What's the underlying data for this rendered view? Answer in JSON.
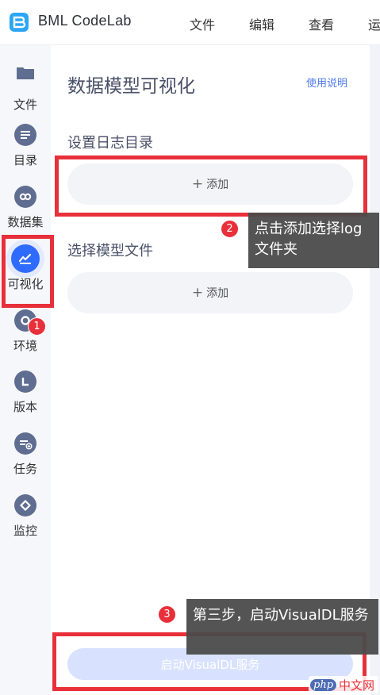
{
  "app": {
    "brand": "BML CodeLab",
    "menu": [
      "文件",
      "编辑",
      "查看",
      "运"
    ]
  },
  "sidebar": {
    "items": [
      {
        "label": "文件",
        "icon": "folder-icon"
      },
      {
        "label": "目录",
        "icon": "list-icon"
      },
      {
        "label": "数据集",
        "icon": "dataset-icon"
      },
      {
        "label": "可视化",
        "icon": "chart-icon",
        "active": true
      },
      {
        "label": "环境",
        "icon": "environment-icon"
      },
      {
        "label": "版本",
        "icon": "version-icon"
      },
      {
        "label": "任务",
        "icon": "task-icon"
      },
      {
        "label": "监控",
        "icon": "monitor-icon"
      }
    ]
  },
  "panel": {
    "title": "数据模型可视化",
    "help_link": "使用说明",
    "log_section_label": "设置日志目录",
    "model_section_label": "选择模型文件",
    "add_label": "添加",
    "start_button": "启动VisualDL服务"
  },
  "annotations": [
    {
      "number": "1"
    },
    {
      "number": "2",
      "text": "点击添加选择log文件夹"
    },
    {
      "number": "3",
      "text": "第三步，启动VisualDL服务"
    }
  ],
  "watermark": {
    "logo": "php",
    "text": "中文网"
  },
  "colors": {
    "accent": "#2f6bff",
    "sidebar_icon": "#5f6d91",
    "highlight": "#e8303a",
    "link": "#4f7cf0"
  }
}
